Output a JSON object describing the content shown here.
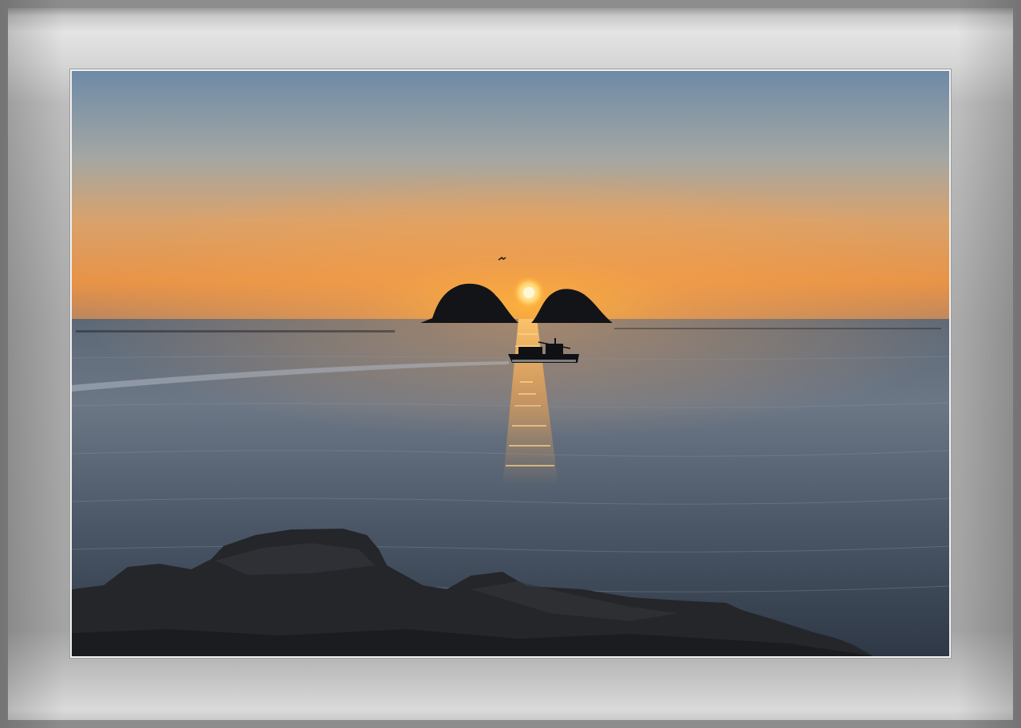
{
  "photo": {
    "subject": "sunset-over-sea",
    "colors": {
      "sky_top": "#6f8aa6",
      "sky_mid": "#c9a27d",
      "sky_glow": "#f3a443",
      "horizon": "#d98a4a",
      "sun": "#fff3c0",
      "sea_dark": "#2c3440",
      "sea_light": "#6f7f8f",
      "silhouette": "#101214",
      "rock": "#2a2a2c",
      "frame": "#b4b4b4"
    }
  }
}
